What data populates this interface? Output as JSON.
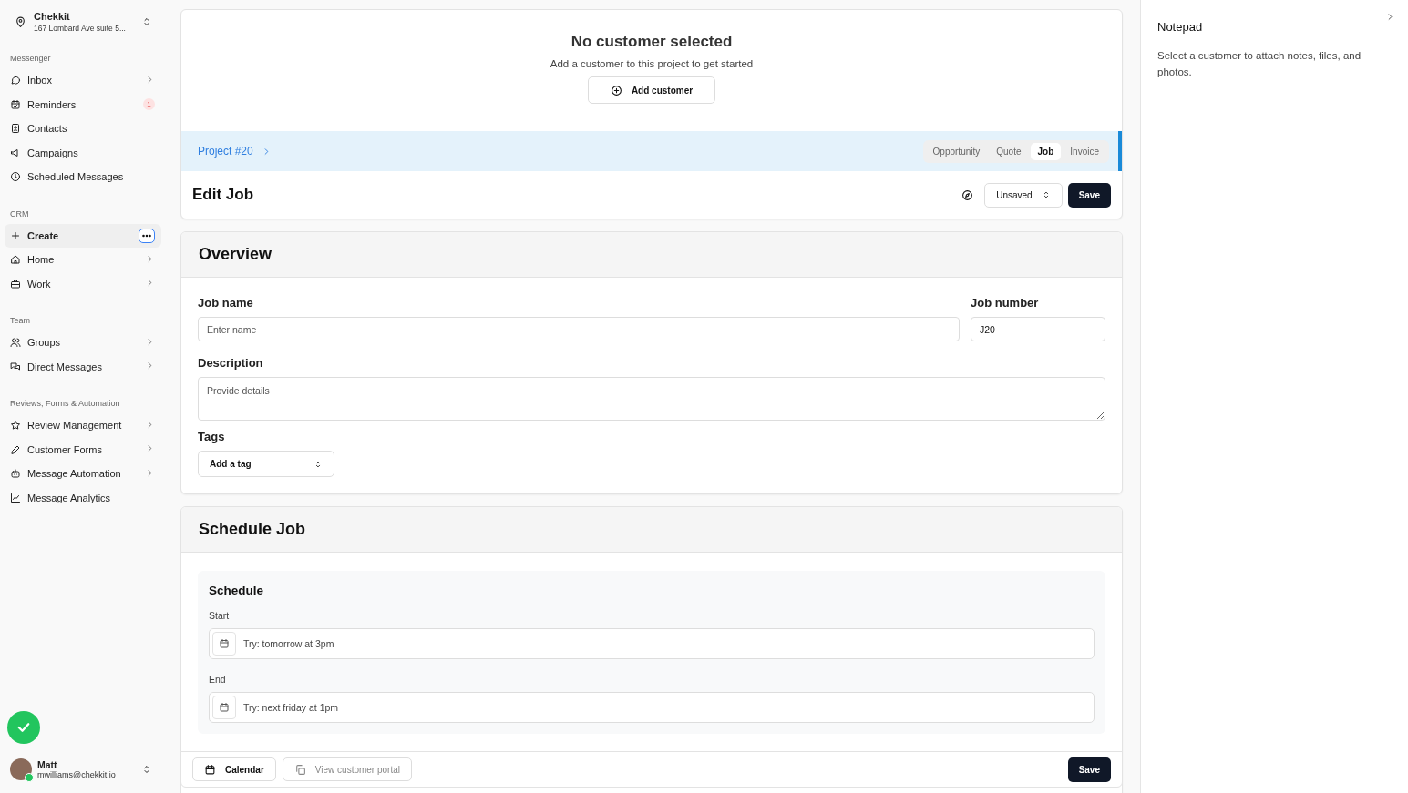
{
  "location": {
    "name": "Chekkit",
    "address": "167 Lombard Ave suite 5..."
  },
  "sidebar": {
    "sections": [
      {
        "title": "Messenger",
        "items": [
          {
            "label": "Inbox",
            "selected": false,
            "expandable": true
          },
          {
            "label": "Reminders",
            "selected": false,
            "expandable": false,
            "badge": "1"
          },
          {
            "label": "Contacts",
            "selected": false,
            "expandable": false
          },
          {
            "label": "Campaigns",
            "selected": false,
            "expandable": false
          },
          {
            "label": "Scheduled Messages",
            "selected": false,
            "expandable": false
          }
        ]
      },
      {
        "title": "CRM",
        "items": [
          {
            "label": "Create",
            "selected": true,
            "expandable": false
          },
          {
            "label": "Home",
            "selected": false,
            "expandable": true
          },
          {
            "label": "Work",
            "selected": false,
            "expandable": true
          }
        ]
      },
      {
        "title": "Team",
        "items": [
          {
            "label": "Groups",
            "selected": false,
            "expandable": true
          },
          {
            "label": "Direct Messages",
            "selected": false,
            "expandable": true
          }
        ]
      },
      {
        "title": "Reviews, Forms & Automation",
        "items": [
          {
            "label": "Review Management",
            "selected": false,
            "expandable": true
          },
          {
            "label": "Customer Forms",
            "selected": false,
            "expandable": true
          },
          {
            "label": "Message Automation",
            "selected": false,
            "expandable": true
          },
          {
            "label": "Message Analytics",
            "selected": false,
            "expandable": false
          }
        ]
      }
    ]
  },
  "user": {
    "name": "Matt",
    "email": "mwilliams@chekkit.io",
    "online": true
  },
  "customer": {
    "title": "No customer selected",
    "subtitle": "Add a customer to this project to get started",
    "button": "Add customer"
  },
  "project": {
    "breadcrumb": "Project #20",
    "stages": [
      {
        "label": "Opportunity",
        "selected": false
      },
      {
        "label": "Quote",
        "selected": false
      },
      {
        "label": "Job",
        "selected": true
      },
      {
        "label": "Invoice",
        "selected": false
      }
    ]
  },
  "editor": {
    "title": "Edit Job",
    "status": "Unsaved",
    "save": "Save"
  },
  "overview": {
    "title": "Overview",
    "job_name": {
      "label": "Job name",
      "placeholder": "Enter name"
    },
    "job_number": {
      "label": "Job number",
      "value": "J20"
    },
    "description": {
      "label": "Description",
      "placeholder": "Provide details"
    },
    "tags": {
      "label": "Tags",
      "button": "Add a tag"
    }
  },
  "schedule": {
    "title": "Schedule Job",
    "subtitle": "Schedule",
    "start": {
      "label": "Start",
      "placeholder": "Try: tomorrow at 3pm"
    },
    "end": {
      "label": "End",
      "placeholder": "Try: next friday at 1pm"
    }
  },
  "footer": {
    "calendar": "Calendar",
    "portal": "View customer portal",
    "portal_disabled": true,
    "save": "Save"
  },
  "notepad": {
    "title": "Notepad",
    "text": "Select a customer to attach notes, files, and photos."
  }
}
